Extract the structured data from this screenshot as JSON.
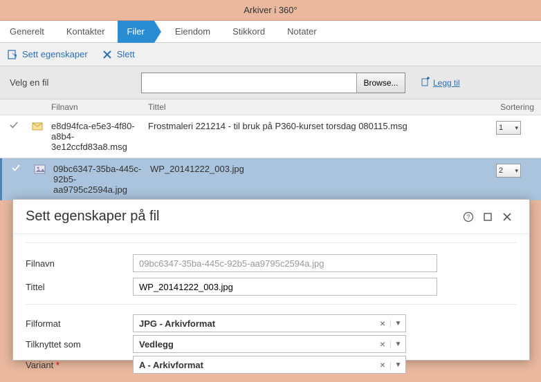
{
  "window": {
    "title": "Arkiver i 360°"
  },
  "tabs": [
    "Generelt",
    "Kontakter",
    "Filer",
    "Eiendom",
    "Stikkord",
    "Notater"
  ],
  "activeTabIndex": 2,
  "actions": {
    "setProps": "Sett egenskaper",
    "delete": "Slett"
  },
  "filePicker": {
    "label": "Velg en fil",
    "browse": "Browse...",
    "addLink": "Legg til"
  },
  "grid": {
    "cols": {
      "filnavn": "Filnavn",
      "tittel": "Tittel",
      "sortering": "Sortering"
    },
    "rows": [
      {
        "selected": false,
        "fileIconType": "msg",
        "filnavn": "e8d94fca-e5e3-4f80-a8b4-3e12ccfd83a8.msg",
        "tittel": "Frostmaleri 221214 - til bruk på P360-kurset torsdag 080115.msg",
        "sort": "1"
      },
      {
        "selected": true,
        "fileIconType": "jpg",
        "filnavn": "09bc6347-35ba-445c-92b5-aa9795c2594a.jpg",
        "tittel": "WP_20141222_003.jpg",
        "sort": "2"
      }
    ]
  },
  "dialog": {
    "title": "Sett egenskaper på fil",
    "fields": {
      "filnavn": {
        "label": "Filnavn",
        "value": "09bc6347-35ba-445c-92b5-aa9795c2594a.jpg"
      },
      "tittel": {
        "label": "Tittel",
        "value": "WP_20141222_003.jpg"
      },
      "filformat": {
        "label": "Filformat",
        "value": "JPG - Arkivformat"
      },
      "tilknyttet": {
        "label": "Tilknyttet som",
        "value": "Vedlegg"
      },
      "variant": {
        "label": "Variant",
        "required": true,
        "value": "A - Arkivformat"
      }
    }
  }
}
